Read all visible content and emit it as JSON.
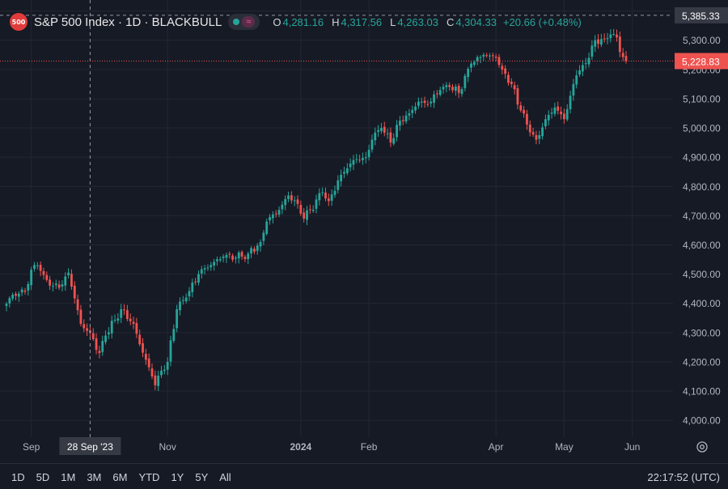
{
  "header": {
    "logo_text": "500",
    "title": "S&P 500 Index · 1D · BLACKBULL",
    "o_label": "O",
    "o_value": "4,281.16",
    "h_label": "H",
    "h_value": "4,317.56",
    "l_label": "L",
    "l_value": "4,263.03",
    "c_label": "C",
    "c_value": "4,304.33",
    "change": "+20.66 (+0.48%)"
  },
  "colors": {
    "background": "#161a25",
    "up": "#26a69a",
    "down": "#ef5350",
    "grid": "#232732",
    "text": "#d1d4dc"
  },
  "price_badges": [
    {
      "label": "5,385.33",
      "value": 5385.33,
      "style": "crosshair"
    },
    {
      "label": "5,228.83",
      "value": 5228.83,
      "style": "last-price"
    }
  ],
  "crosshair_date_label": "28 Sep '23",
  "footer": {
    "ranges": [
      "1D",
      "5D",
      "1M",
      "3M",
      "6M",
      "YTD",
      "1Y",
      "5Y",
      "All"
    ],
    "clock": "22:17:52 (UTC)"
  },
  "chart_data": {
    "type": "candlestick",
    "symbol": "S&P 500 Index",
    "interval": "1D",
    "source": "BLACKBULL",
    "ylim": [
      3970,
      5410
    ],
    "y_ticks": [
      4000,
      4100,
      4200,
      4300,
      4400,
      4500,
      4600,
      4700,
      4800,
      4900,
      5000,
      5100,
      5200,
      5300,
      5400
    ],
    "y_tick_labels": [
      "4,000.00",
      "4,100.00",
      "4,200.00",
      "4,300.00",
      "4,400.00",
      "4,500.00",
      "4,600.00",
      "4,700.00",
      "4,800.00",
      "4,900.00",
      "5,000.00",
      "5,100.00",
      "5,200.00",
      "5,300.00",
      "5,300.00"
    ],
    "x_start_date": "2023-08-21",
    "x_ticks": [
      {
        "label": "Sep",
        "index": 8,
        "bold": false
      },
      {
        "label": "Nov",
        "index": 52,
        "bold": false
      },
      {
        "label": "2024",
        "index": 95,
        "bold": true
      },
      {
        "label": "Feb",
        "index": 117,
        "bold": false
      },
      {
        "label": "Apr",
        "index": 158,
        "bold": false
      },
      {
        "label": "May",
        "index": 180,
        "bold": false
      },
      {
        "label": "Jun",
        "index": 202,
        "bold": false
      }
    ],
    "crosshair_index": 27,
    "key_closes": [
      [
        0,
        4399
      ],
      [
        2,
        4430
      ],
      [
        6,
        4440
      ],
      [
        8,
        4515
      ],
      [
        10,
        4530
      ],
      [
        12,
        4497
      ],
      [
        15,
        4460
      ],
      [
        18,
        4465
      ],
      [
        20,
        4505
      ],
      [
        24,
        4330
      ],
      [
        27,
        4300
      ],
      [
        30,
        4230
      ],
      [
        32,
        4290
      ],
      [
        37,
        4380
      ],
      [
        41,
        4330
      ],
      [
        43,
        4260
      ],
      [
        47,
        4150
      ],
      [
        48,
        4120
      ],
      [
        50,
        4170
      ],
      [
        52,
        4200
      ],
      [
        55,
        4380
      ],
      [
        58,
        4420
      ],
      [
        62,
        4500
      ],
      [
        64,
        4520
      ],
      [
        70,
        4560
      ],
      [
        76,
        4560
      ],
      [
        78,
        4570
      ],
      [
        82,
        4610
      ],
      [
        84,
        4680
      ],
      [
        88,
        4720
      ],
      [
        91,
        4769
      ],
      [
        94,
        4740
      ],
      [
        96,
        4690
      ],
      [
        98,
        4720
      ],
      [
        102,
        4780
      ],
      [
        104,
        4750
      ],
      [
        108,
        4840
      ],
      [
        112,
        4890
      ],
      [
        116,
        4900
      ],
      [
        118,
        4960
      ],
      [
        121,
        5000
      ],
      [
        124,
        4950
      ],
      [
        127,
        5025
      ],
      [
        130,
        5050
      ],
      [
        133,
        5090
      ],
      [
        136,
        5080
      ],
      [
        140,
        5130
      ],
      [
        143,
        5140
      ],
      [
        146,
        5120
      ],
      [
        150,
        5220
      ],
      [
        154,
        5250
      ],
      [
        158,
        5240
      ],
      [
        160,
        5200
      ],
      [
        163,
        5150
      ],
      [
        166,
        5060
      ],
      [
        169,
        4985
      ],
      [
        171,
        4960
      ],
      [
        174,
        5030
      ],
      [
        177,
        5070
      ],
      [
        180,
        5030
      ],
      [
        182,
        5110
      ],
      [
        184,
        5180
      ],
      [
        186,
        5215
      ],
      [
        188,
        5240
      ],
      [
        190,
        5300
      ],
      [
        193,
        5305
      ],
      [
        195,
        5320
      ],
      [
        197,
        5310
      ],
      [
        198,
        5260
      ],
      [
        200,
        5229
      ]
    ]
  }
}
